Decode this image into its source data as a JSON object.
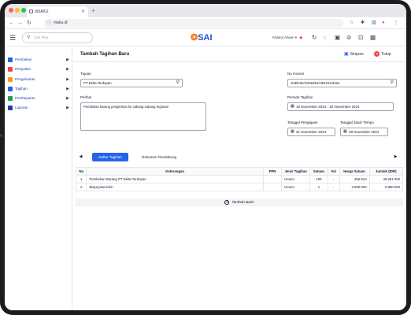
{
  "browser": {
    "tab_title": "diSAKU",
    "new_tab": "+",
    "url": "maku.id",
    "icons": [
      "back-icon",
      "forward-icon",
      "reload-icon",
      "star-icon",
      "extensions-icon",
      "sidepanel-icon",
      "profile-icon",
      "menu-icon"
    ]
  },
  "header": {
    "search_placeholder": "Cari Fitur",
    "logo_text": "SAI",
    "user_name": "Khairul Afwan",
    "icons": [
      "menu-icon",
      "search-icon",
      "notification-icon",
      "refresh-icon",
      "chat-icon",
      "inbox-icon",
      "link-icon",
      "qr-icon",
      "apps-icon"
    ]
  },
  "sidebar": {
    "items": [
      {
        "label": "Pembelian",
        "color": "#2563eb"
      },
      {
        "label": "Penjualan",
        "color": "#ef4444"
      },
      {
        "label": "Pengeluaran",
        "color": "#f59e0b"
      },
      {
        "label": "Tagihan",
        "color": "#2563eb"
      },
      {
        "label": "Pembayaran",
        "color": "#16a34a"
      },
      {
        "label": "Laporan",
        "color": "#1e40af"
      }
    ]
  },
  "page": {
    "title": "Tambah Tagihan Baru",
    "save_label": "Simpan",
    "close_label": "Tutup"
  },
  "form": {
    "tujuan_label": "Tujuan",
    "tujuan_value": "PT Delta Terdepan",
    "perihal_label": "Perihal",
    "perihal_value": "Pembelian barang pengiriman ke cabang-cabang regional",
    "invoice_label": "No Invoice",
    "invoice_value": "1039/JDA/0049/61/HDH/11/2024",
    "periode_label": "Periode Tagihan",
    "periode_value": "10 November 2024 - 20 November 2024",
    "tgl_pengajuan_label": "Tanggal Pengajuan",
    "tgl_pengajuan_value": "21 November 2024",
    "tgl_jatuh_tempo_label": "Tanggal Jatuh Tempo",
    "tgl_jatuh_tempo_value": "28 November 2024"
  },
  "tabs": {
    "prev": "◀",
    "next": "▶",
    "items": [
      "Daftar Tagihan",
      "Dokumen Pendukung"
    ],
    "active": 0
  },
  "table": {
    "headers": [
      "No",
      "Keterangan",
      "PPN",
      "Jenis Tagihan",
      "Satuan",
      "Vol",
      "Harga Satuan",
      "Jumlah (IDR)"
    ],
    "rows": [
      [
        "1",
        "Pembelian Barang PT Delta Terdepan",
        "",
        "Umum",
        "100",
        "-",
        "456.510",
        "45.651.000"
      ],
      [
        "2",
        "Biaya jasa kirim",
        "",
        "Umum",
        "1",
        "-",
        "2.890.000",
        "2.890.000"
      ]
    ],
    "add_row_label": "Tambah Baris"
  },
  "colors": {
    "accent": "#2563eb",
    "danger": "#ef4444",
    "logo_mark": "#f97316"
  }
}
